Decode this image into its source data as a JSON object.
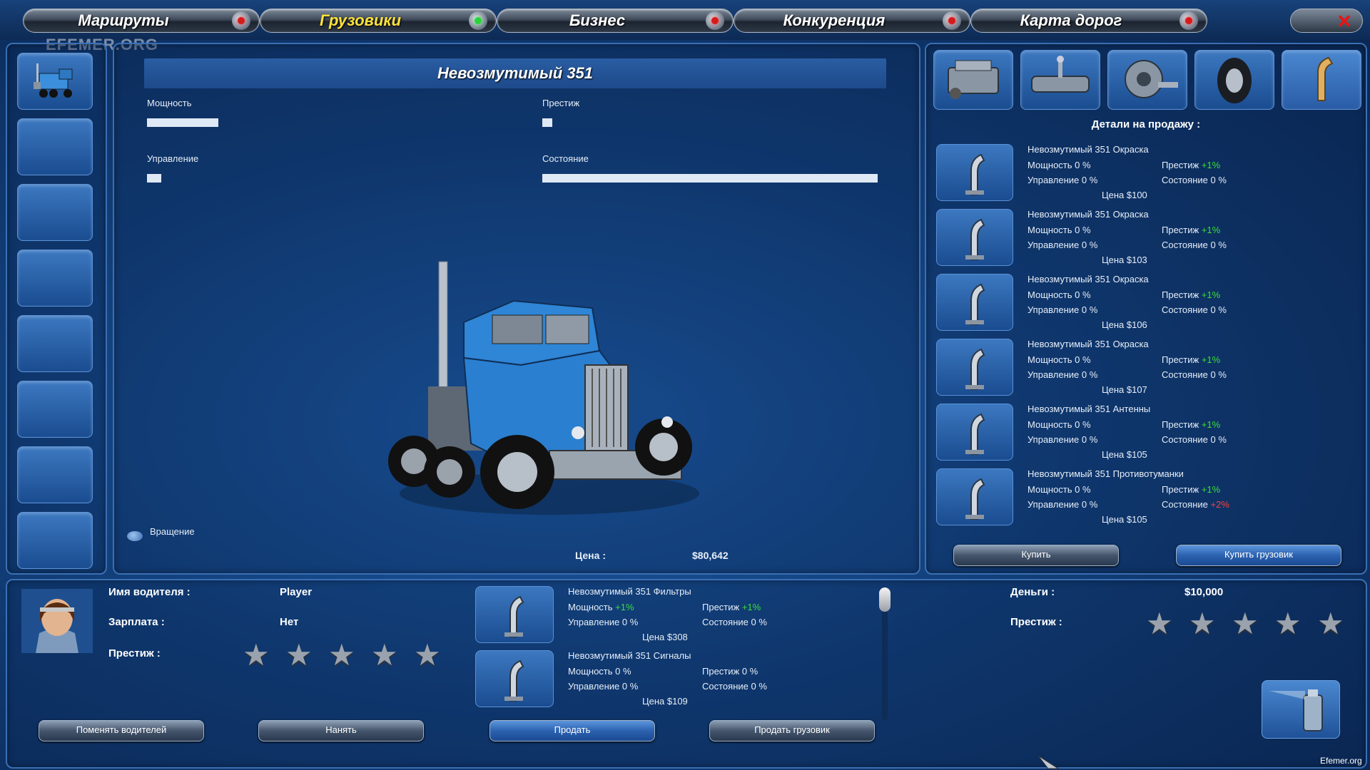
{
  "nav": {
    "items": [
      {
        "label": "Маршруты"
      },
      {
        "label": "Грузовики"
      },
      {
        "label": "Бизнес"
      },
      {
        "label": "Конкуренция"
      },
      {
        "label": "Карта дорог"
      }
    ],
    "active_index": 1
  },
  "watermark": "EFEMER.ORG",
  "truck": {
    "name": "Невозмутимый 351",
    "stats": {
      "power_label": "Мощность",
      "power_value": 0.2,
      "prestige_label": "Престиж",
      "prestige_value": 0.03,
      "handling_label": "Управление",
      "handling_value": 0.04,
      "condition_label": "Состояние",
      "condition_value": 1.0
    },
    "rotation_label": "Вращение",
    "price_label": "Цена :",
    "price_value": "$80,642"
  },
  "shop": {
    "categories": [
      "engine-icon",
      "transmission-icon",
      "brake-icon",
      "tire-icon",
      "exhaust-icon"
    ],
    "title": "Детали на продажу :",
    "items": [
      {
        "name": "Невозмутимый 351 Окраска",
        "power": "Мощность 0 %",
        "prestige": "Престиж",
        "prestige_delta": "+1%",
        "handling": "Управление 0 %",
        "condition": "Состояние",
        "condition_delta": "0 %",
        "price": "Цена $100"
      },
      {
        "name": "Невозмутимый 351 Окраска",
        "power": "Мощность 0 %",
        "prestige": "Престиж",
        "prestige_delta": "+1%",
        "handling": "Управление 0 %",
        "condition": "Состояние",
        "condition_delta": "0 %",
        "price": "Цена $103"
      },
      {
        "name": "Невозмутимый 351 Окраска",
        "power": "Мощность 0 %",
        "prestige": "Престиж",
        "prestige_delta": "+1%",
        "handling": "Управление 0 %",
        "condition": "Состояние",
        "condition_delta": "0 %",
        "price": "Цена $106"
      },
      {
        "name": "Невозмутимый 351 Окраска",
        "power": "Мощность 0 %",
        "prestige": "Престиж",
        "prestige_delta": "+1%",
        "handling": "Управление 0 %",
        "condition": "Состояние",
        "condition_delta": "0 %",
        "price": "Цена $107"
      },
      {
        "name": "Невозмутимый 351 Антенны",
        "power": "Мощность 0 %",
        "prestige": "Престиж",
        "prestige_delta": "+1%",
        "handling": "Управление 0 %",
        "condition": "Состояние",
        "condition_delta": "0 %",
        "price": "Цена $105"
      },
      {
        "name": "Невозмутимый 351 Противотуманки",
        "power": "Мощность 0 %",
        "prestige": "Престиж",
        "prestige_delta": "+1%",
        "handling": "Управление 0 %",
        "condition": "Состояние",
        "condition_delta": "+2%",
        "condition_red": true,
        "price": "Цена $105"
      }
    ],
    "buy_label": "Купить",
    "buy_truck_label": "Купить грузовик"
  },
  "driver": {
    "name_label": "Имя водителя :",
    "name_value": "Player",
    "salary_label": "Зарплата :",
    "salary_value": "Нет",
    "prestige_label": "Престиж :",
    "prestige_stars": 0,
    "change_label": "Поменять водителей",
    "hire_label": "Нанять"
  },
  "installed": {
    "items": [
      {
        "name": "Невозмутимый 351 Фильтры",
        "power": "Мощность",
        "power_delta": "+1%",
        "prestige": "Престиж",
        "prestige_delta": "+1%",
        "handling": "Управление 0 %",
        "condition": "Состояние 0 %",
        "price": "Цена $308"
      },
      {
        "name": "Невозмутимый 351 Сигналы",
        "power": "Мощность 0 %",
        "prestige": "Престиж 0 %",
        "handling": "Управление 0 %",
        "condition": "Состояние 0 %",
        "price": "Цена $109"
      }
    ],
    "sell_label": "Продать",
    "sell_truck_label": "Продать грузовик"
  },
  "company": {
    "money_label": "Деньги :",
    "money_value": "$10,000",
    "prestige_label": "Престиж :",
    "prestige_stars": 0
  },
  "footer_watermark": "Efemer.org"
}
